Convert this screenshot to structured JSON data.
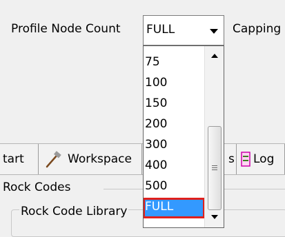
{
  "options_row": {
    "profile_node_count_label": "Profile Node Count",
    "profile_node_count_value": "FULL",
    "capping_label": "Capping"
  },
  "tabs": [
    {
      "label": "tart"
    },
    {
      "label": "Workspace"
    },
    {
      "label": "s"
    },
    {
      "label": "Log"
    }
  ],
  "sections": {
    "rock_codes_label": "Rock Codes",
    "rock_code_library_label": "Rock Code Library"
  },
  "dropdown": {
    "options": [
      "75",
      "100",
      "150",
      "200",
      "300",
      "400",
      "500",
      "FULL"
    ],
    "selected": "FULL"
  },
  "colors": {
    "selection_bg": "#3399ff",
    "selection_outline": "#e0201c"
  }
}
